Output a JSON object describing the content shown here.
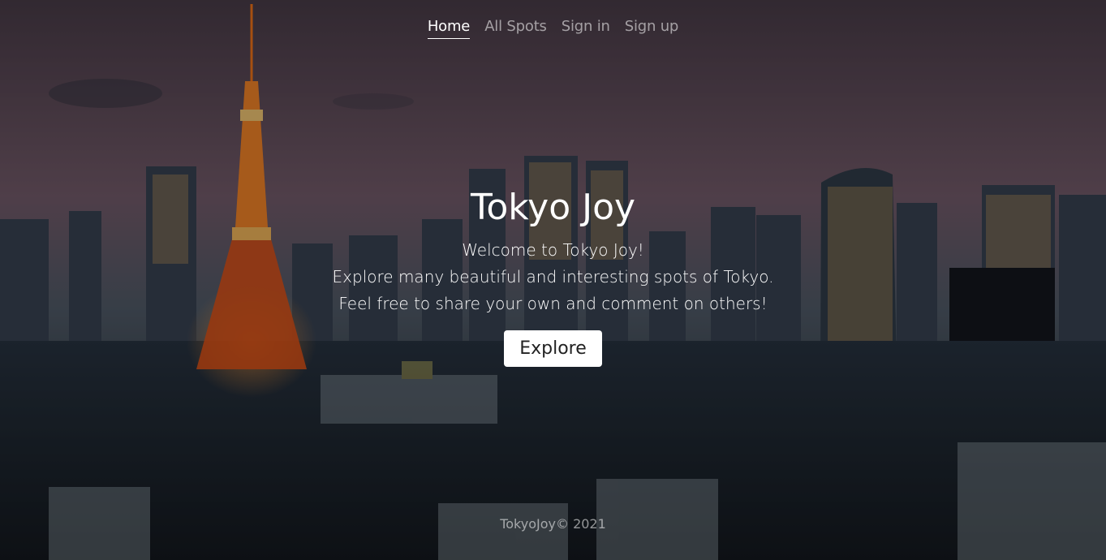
{
  "nav": {
    "items": [
      {
        "label": "Home",
        "active": true
      },
      {
        "label": "All Spots",
        "active": false
      },
      {
        "label": "Sign in",
        "active": false
      },
      {
        "label": "Sign up",
        "active": false
      }
    ]
  },
  "hero": {
    "title": "Tokyo Joy",
    "lines": [
      "Welcome to Tokyo Joy!",
      "Explore many beautiful and interesting spots of Tokyo.",
      "Feel free to share your own and comment on others!"
    ],
    "button_label": "Explore"
  },
  "footer": {
    "text": "TokyoJoy© 2021"
  },
  "colors": {
    "sky_top": "#5a4a58",
    "sky_horizon": "#7a6070",
    "city_dark": "#1c2530",
    "tower_orange": "#ff7a1a"
  }
}
